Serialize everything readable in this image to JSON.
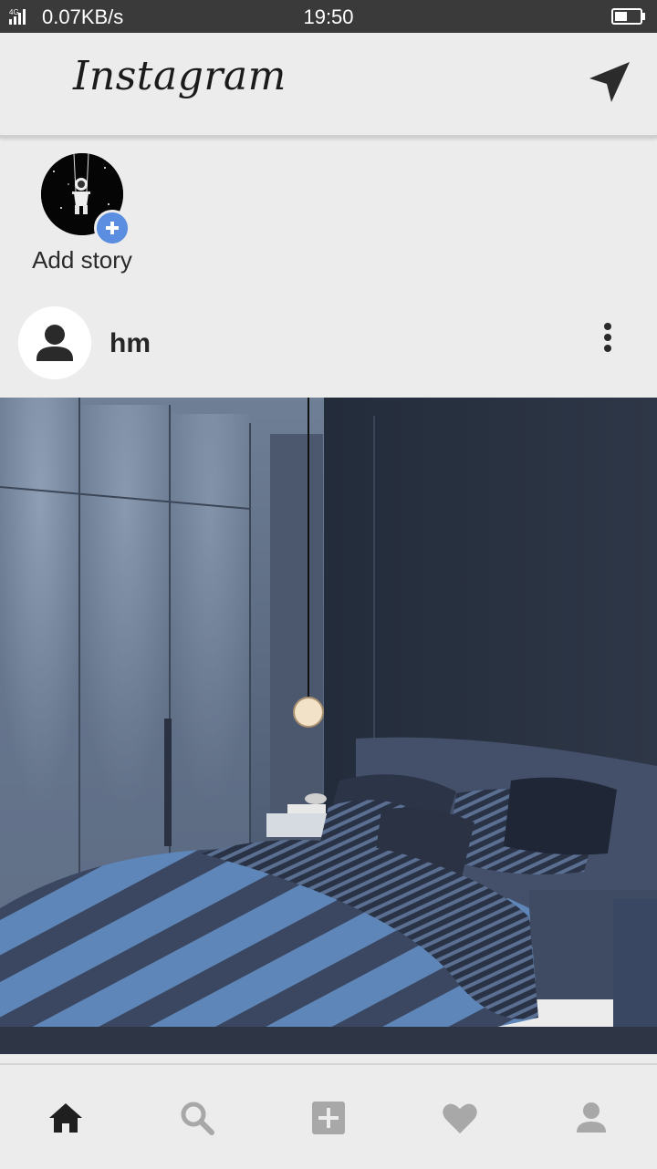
{
  "status_bar": {
    "network": "4G",
    "speed": "0.07KB/s",
    "time": "19:50",
    "battery_level": 0.5
  },
  "header": {
    "app_title": "Instagram",
    "direct_icon": "paper-plane-icon"
  },
  "stories": [
    {
      "label": "Add story",
      "icon": "add-story-icon"
    }
  ],
  "post": {
    "username": "hm",
    "menu_icon": "more-vertical-icon"
  },
  "bottom_nav": {
    "items": [
      "home-icon",
      "search-icon",
      "add-post-icon",
      "heart-icon",
      "profile-icon"
    ],
    "active": "home-icon"
  },
  "colors": {
    "background": "#ececec",
    "accent_blue": "#5b8ee0",
    "icon_dark": "#2a2a2a",
    "icon_inactive": "#a8a8a8"
  }
}
